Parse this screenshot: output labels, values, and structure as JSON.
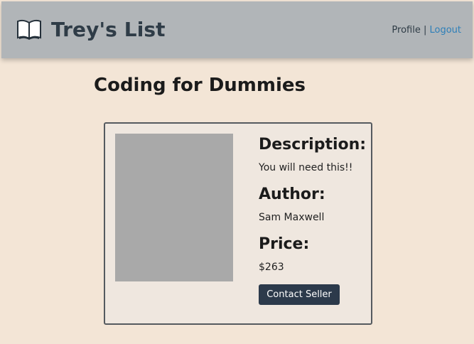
{
  "app": {
    "brand_icon": "open-book-icon",
    "brand_title": "Trey's List"
  },
  "nav": {
    "profile_label": "Profile",
    "separator": "|",
    "logout_label": "Logout"
  },
  "listing": {
    "title": "Coding for Dummies",
    "description_heading": "Description:",
    "description": "You will need this!!",
    "author_heading": "Author:",
    "author": "Sam Maxwell",
    "price_heading": "Price:",
    "price": "$263",
    "contact_label": "Contact Seller"
  },
  "colors": {
    "page_background": "#f3e5d6",
    "navbar_background": "#b1b5b8",
    "brand_text": "#2f3c47",
    "link": "#2d7fb8",
    "card_background": "#efe7df",
    "card_border": "#555a5f",
    "image_placeholder": "#a9a9a9",
    "button_background": "#2c3a4b"
  }
}
